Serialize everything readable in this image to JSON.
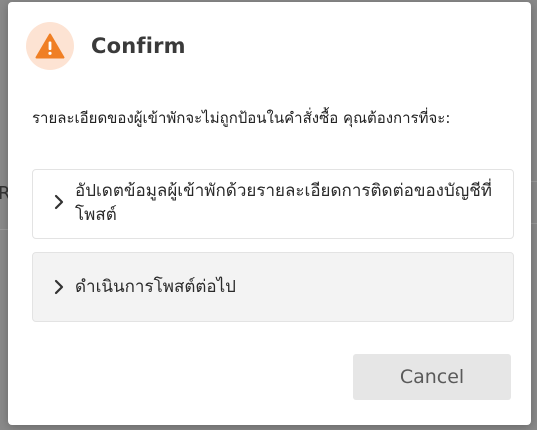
{
  "dialog": {
    "title": "Confirm",
    "icon": "warning-icon",
    "accent_color": "#f07f24",
    "message": "รายละเอียดของผู้เข้าพักจะไม่ถูกป้อนในคำสั่งซื้อ คุณต้องการที่จะ:",
    "options": [
      {
        "label": "อัปเดตข้อมูลผู้เข้าพักด้วยรายละเอียดการติดต่อของบัญชีที่โพสต์",
        "icon": "chevron-right-icon"
      },
      {
        "label": "ดำเนินการโพสต์ต่อไป",
        "icon": "chevron-right-icon"
      }
    ],
    "cancel_label": "Cancel"
  },
  "background": {
    "left_glyph": "R"
  }
}
